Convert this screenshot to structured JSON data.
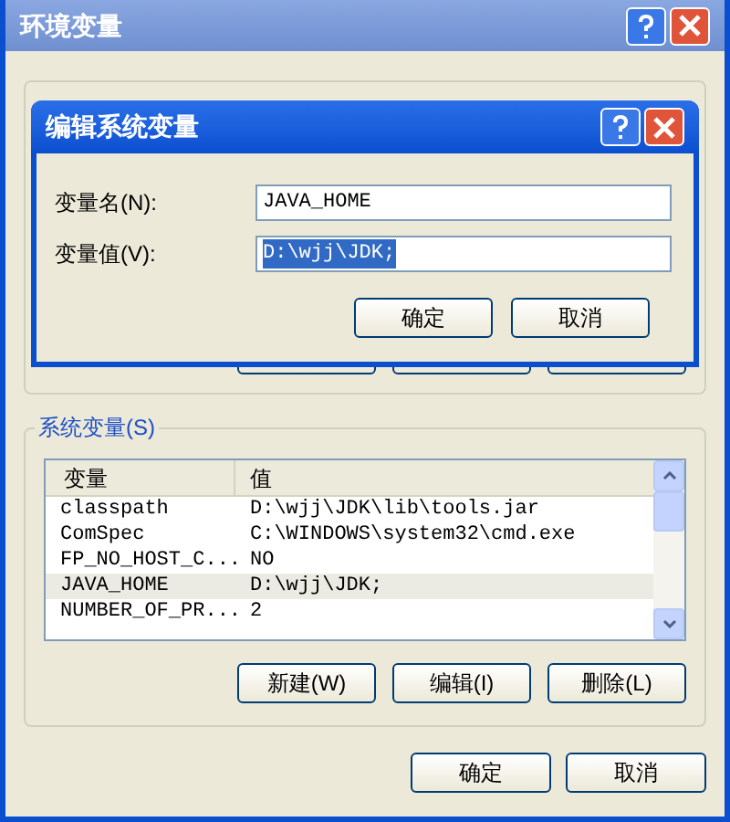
{
  "window": {
    "title": "环境变量"
  },
  "system_variables": {
    "label": "系统变量(S)",
    "columns": [
      "变量",
      "值"
    ],
    "rows": [
      {
        "name": "classpath",
        "value": "D:\\wjj\\JDK\\lib\\tools.jar",
        "selected": false
      },
      {
        "name": "ComSpec",
        "value": "C:\\WINDOWS\\system32\\cmd.exe",
        "selected": false
      },
      {
        "name": "FP_NO_HOST_C...",
        "value": "NO",
        "selected": false
      },
      {
        "name": "JAVA_HOME",
        "value": "D:\\wjj\\JDK;",
        "selected": true
      },
      {
        "name": "NUMBER_OF_PR...",
        "value": "2",
        "selected": false
      }
    ],
    "buttons": [
      "新建(W)",
      "编辑(I)",
      "删除(L)"
    ]
  },
  "footer_buttons": [
    "确定",
    "取消"
  ],
  "dialog": {
    "title": "编辑系统变量",
    "fields": [
      {
        "label": "变量名(N):",
        "value": "JAVA_HOME",
        "text_selected": false
      },
      {
        "label": "变量值(V):",
        "value": "D:\\wjj\\JDK;",
        "text_selected": true
      }
    ],
    "buttons": [
      "确定",
      "取消"
    ]
  }
}
